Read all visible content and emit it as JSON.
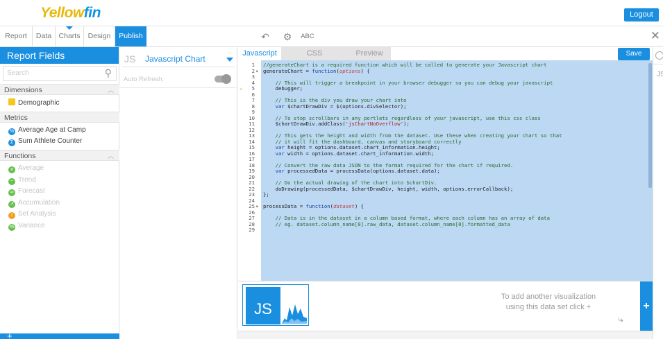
{
  "app": {
    "logo_prefix": "Yellow",
    "logo_suffix": "fin",
    "logout_label": "Logout"
  },
  "nav": {
    "tabs": [
      {
        "label": "Report"
      },
      {
        "label": "Data"
      },
      {
        "label": "Charts"
      },
      {
        "label": "Design"
      },
      {
        "label": "Publish"
      }
    ],
    "tools": {
      "undo_icon": "undo-icon",
      "settings_icon": "gear-icon",
      "spellcheck_label": "ABC",
      "close_icon": "close-icon"
    }
  },
  "report_fields": {
    "title": "Report Fields",
    "search_placeholder": "Search",
    "sections": {
      "dimensions": {
        "label": "Dimensions",
        "items": [
          {
            "label": "Demographic"
          }
        ]
      },
      "metrics": {
        "label": "Metrics",
        "items": [
          {
            "label": "Average Age at Camp"
          },
          {
            "label": "Sum Athlete Counter"
          }
        ]
      },
      "functions": {
        "label": "Functions",
        "items": [
          {
            "label": "Average"
          },
          {
            "label": "Trend"
          },
          {
            "label": "Forecast"
          },
          {
            "label": "Accumulation"
          },
          {
            "label": "Set Analysis"
          },
          {
            "label": "Variance"
          }
        ]
      }
    },
    "footer_add": "+"
  },
  "chart_settings": {
    "chart_type_icon": "JS",
    "chart_type_label": "Javascript Chart",
    "auto_refresh_label": "Auto Refresh:",
    "auto_refresh_on": true
  },
  "editor": {
    "tabs": [
      {
        "label": "Javascript"
      },
      {
        "label": "CSS"
      },
      {
        "label": "Preview"
      }
    ],
    "active_tab": "Javascript",
    "save_label": "Save",
    "warning_line": "5",
    "code": [
      {
        "n": "1",
        "fold": "",
        "text": "//generateChart is a required function which will be called to generate your Javascript chart"
      },
      {
        "n": "2",
        "fold": "▾",
        "text": "generateChart = function(options) {"
      },
      {
        "n": "3",
        "fold": "",
        "text": ""
      },
      {
        "n": "4",
        "fold": "",
        "text": "    // This will trigger a breakpoint in your browser debugger so you can debug your javascript"
      },
      {
        "n": "5",
        "fold": "",
        "text": "    debugger;"
      },
      {
        "n": "6",
        "fold": "",
        "text": ""
      },
      {
        "n": "7",
        "fold": "",
        "text": "    // This is the div you draw your chart into"
      },
      {
        "n": "8",
        "fold": "",
        "text": "    var $chartDrawDiv = $(options.divSelector);"
      },
      {
        "n": "9",
        "fold": "",
        "text": ""
      },
      {
        "n": "10",
        "fold": "",
        "text": "    // To stop scrollbars in any portlets regardless of your javascript, use this css class"
      },
      {
        "n": "11",
        "fold": "",
        "text": "    $chartDrawDiv.addClass('jsChartNoOverflow');"
      },
      {
        "n": "12",
        "fold": "",
        "text": ""
      },
      {
        "n": "13",
        "fold": "",
        "text": "    // This gets the height and width from the dataset. Use these when creating your chart so that"
      },
      {
        "n": "14",
        "fold": "",
        "text": "    // it will fit the dashboard, canvas and storyboard correctly"
      },
      {
        "n": "15",
        "fold": "",
        "text": "    var height = options.dataset.chart_information.height;"
      },
      {
        "n": "16",
        "fold": "",
        "text": "    var width = options.dataset.chart_information.width;"
      },
      {
        "n": "17",
        "fold": "",
        "text": ""
      },
      {
        "n": "18",
        "fold": "",
        "text": "    // Convert the raw data JSON to the format required for the chart if required."
      },
      {
        "n": "19",
        "fold": "",
        "text": "    var processedData = processData(options.dataset.data);"
      },
      {
        "n": "20",
        "fold": "",
        "text": ""
      },
      {
        "n": "21",
        "fold": "",
        "text": "    // Do the actual drawing of the chart into $chartDiv."
      },
      {
        "n": "22",
        "fold": "",
        "text": "    doDrawing(processedData, $chartDrawDiv, height, width, options.errorCallback);"
      },
      {
        "n": "23",
        "fold": "",
        "text": "};"
      },
      {
        "n": "24",
        "fold": "",
        "text": ""
      },
      {
        "n": "25",
        "fold": "▾",
        "text": "processData = function(dataset) {"
      },
      {
        "n": "26",
        "fold": "",
        "text": ""
      },
      {
        "n": "27",
        "fold": "",
        "text": "    // Data is in the dataset in a column based format, where each column has an array of data"
      },
      {
        "n": "28",
        "fold": "",
        "text": "    // eg. dataset.column_name[0].raw_data, dataset.column_name[0].formatted_data"
      },
      {
        "n": "29",
        "fold": "",
        "text": ""
      }
    ]
  },
  "visualization": {
    "thumbnail_label": "JS",
    "hint_line1": "To add another visualization",
    "hint_line2": "using this data set click +",
    "add_label": "+"
  },
  "right_rail": {
    "label": "JS"
  },
  "colors": {
    "brand_blue": "#1a8fe0",
    "brand_yellow": "#e8b90b",
    "selection": "#bcd8f3"
  }
}
